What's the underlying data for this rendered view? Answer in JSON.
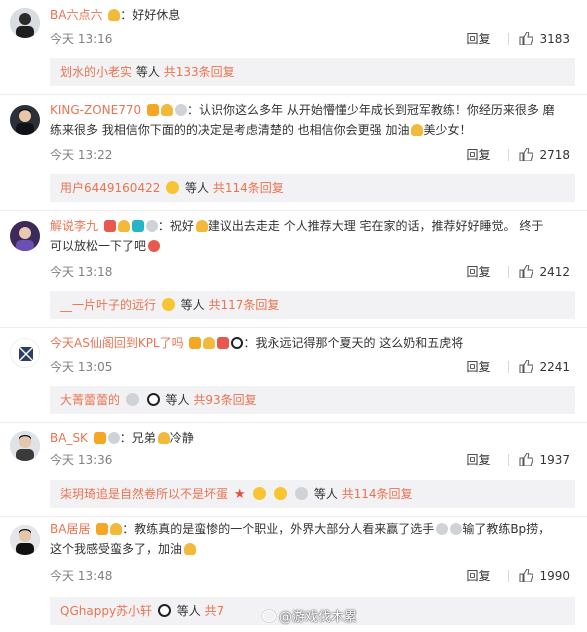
{
  "comments": [
    {
      "username": "BA六点六",
      "text": "好好休息",
      "time": "今天 13:16",
      "reply_label": "回复",
      "likes": "3183",
      "sub_user": "划水的小老实",
      "sub_mid": "等人",
      "sub_count": "共133条回复"
    },
    {
      "username": "KING-ZONE770",
      "text": "认识你这么多年 从开始懵懂少年成长到冠军教练！你经历来很多 磨",
      "text2": "练来很多 我相信你下面的的决定是考虑清楚的 也相信你会更强 加油",
      "text2b": "美少女！",
      "time": "今天 13:22",
      "reply_label": "回复",
      "likes": "2718",
      "sub_user": "用户6449160422",
      "sub_mid": "等人",
      "sub_count": "共114条回复"
    },
    {
      "username": "解说李九",
      "text": "祝好",
      "text_b": "建议出去走走 个人推荐大理 宅在家的话，推荐好好睡觉。 终于",
      "text2": "可以放松一下了吧",
      "time": "今天 13:18",
      "reply_label": "回复",
      "likes": "2412",
      "sub_user": "__一片叶子的远行",
      "sub_mid": "等人",
      "sub_count": "共117条回复"
    },
    {
      "username": "今天AS仙阁回到KPL了吗",
      "text": "我永远记得那个夏天的 这么奶和五虎将",
      "time": "今天 13:05",
      "reply_label": "回复",
      "likes": "2241",
      "sub_user": "大菁蕾蕾的",
      "sub_mid": "等人",
      "sub_count": "共93条回复"
    },
    {
      "username": "BA_SK",
      "text": "兄弟",
      "text_b": "冷静",
      "time": "今天 13:36",
      "reply_label": "回复",
      "likes": "1937",
      "sub_user": "柒玥琦追是自然卷所以不是坏蛋",
      "sub_mid": "等人",
      "sub_count": "共114条回复"
    },
    {
      "username": "BA居居",
      "text": "教练真的是蛮惨的一个职业，外界大部分人看来赢了选手",
      "text_b": "输了教练Bp捞，",
      "text2": "这个我感受蛮多了，加油",
      "time": "今天 13:48",
      "reply_label": "回复",
      "likes": "1990",
      "sub_user": "QGhappy苏小轩",
      "sub_mid": "等人",
      "sub_count": "共7"
    }
  ],
  "watermark": "@游戏伐木累",
  "colors": {
    "username": "#eb7350",
    "meta": "#808080",
    "subbox_bg": "#f2f2f5",
    "badge_v": "#f5a623"
  },
  "icons": {
    "like": "thumbs-up-icon",
    "badge": "vip-badge-icon"
  }
}
